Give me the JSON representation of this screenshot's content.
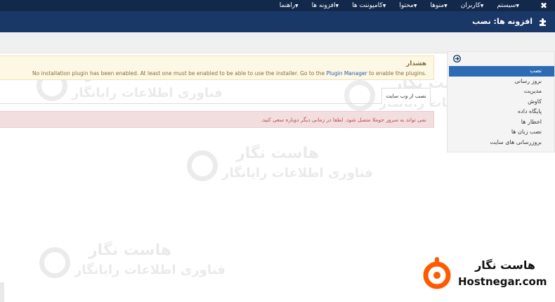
{
  "top_menu": {
    "items": [
      {
        "label": "سیستم"
      },
      {
        "label": "کاربران"
      },
      {
        "label": "منوها"
      },
      {
        "label": "محتوا"
      },
      {
        "label": "کامپوننت ها"
      },
      {
        "label": "افزونه ها"
      },
      {
        "label": "راهنما"
      }
    ],
    "logo_icon": "joomla-icon"
  },
  "title_bar": {
    "title": "افزونه ها: نصب",
    "icon": "puzzle-icon"
  },
  "sidebar": {
    "collapse_icon": "circle-arrow-icon",
    "items": [
      {
        "label": "نصب",
        "active": true
      },
      {
        "label": "بروز رسانی",
        "active": false
      },
      {
        "label": "مدیریت",
        "active": false
      },
      {
        "label": "کاوش",
        "active": false
      },
      {
        "label": "پایگاه داده",
        "active": false
      },
      {
        "label": "اخطار ها",
        "active": false
      },
      {
        "label": "نصب زبان ها",
        "active": false
      },
      {
        "label": "بروزرسانی های سایت",
        "active": false
      }
    ]
  },
  "warning": {
    "title": "هشدار",
    "message_before": "No installation plugin has been enabled. At least one must be enabled to be able to use the installer. Go to the ",
    "link_text": "Plugin Manager",
    "message_after": " to enable the plugins.",
    "color": "#fcf8e3"
  },
  "tabs": [
    {
      "label": "نصب از وب سایت"
    }
  ],
  "error": {
    "message": "نمی تواند به سرور جوملا متصل شود. لطفا در زمانی دیگر دوباره سعی کنید.",
    "color": "#f2dede"
  },
  "watermark": {
    "line1": "هاست نگار",
    "line2": "فناوری اطلاعات رایانگار"
  },
  "brand": {
    "name_fa": "هاست نگار",
    "name_en": "Hostnegar.com",
    "accent": "#ff5a00"
  }
}
